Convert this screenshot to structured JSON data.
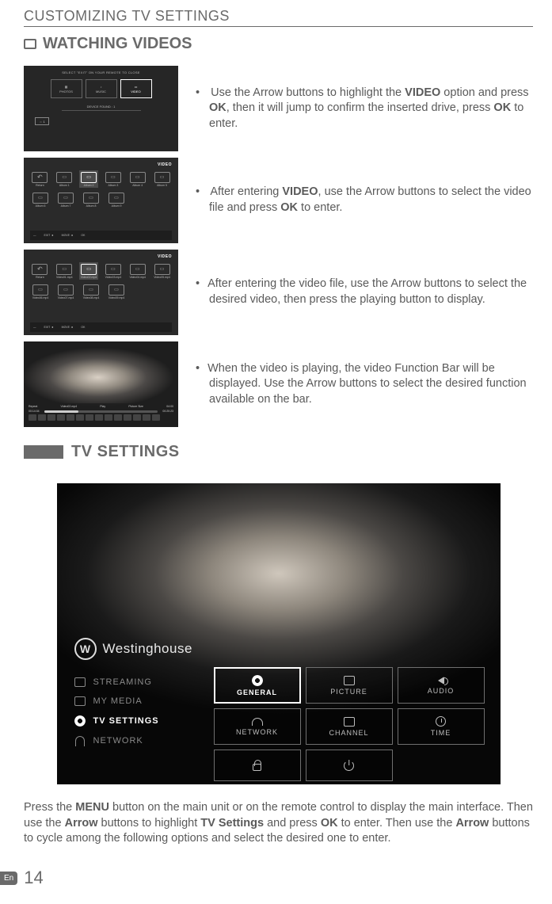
{
  "header": "CUSTOMIZING TV SETTINGS",
  "section1": {
    "title": "WATCHING VIDEOS",
    "steps": [
      {
        "text_pre": "Use the Arrow buttons to highlight the ",
        "b1": "VIDEO",
        "mid1": " option and press ",
        "b2": "OK",
        "mid2": ", then it will jump to confirm the inserted drive, press ",
        "b3": "OK",
        "end": " to enter."
      },
      {
        "text_pre": "After entering ",
        "b1": "VIDEO",
        "mid1": ", use the Arrow buttons to select the video file and press ",
        "b2": "OK",
        "end": " to enter."
      },
      {
        "full": "After entering the video file, use the Arrow buttons to select the desired video, then press the playing button to display."
      },
      {
        "full": "When the video is playing, the video Function Bar will be displayed. Use the Arrow buttons to select the desired function available on the bar."
      }
    ]
  },
  "thumb1": {
    "top_label": "SELECT \"EXIT\" ON YOUR REMOTE TO CLOSE",
    "cards": [
      "PHOTOS",
      "MUSIC",
      "VIDEO"
    ],
    "device": "DEVICE FOUND : 1",
    "usb": "⇔ 1"
  },
  "thumb2": {
    "header": "VIDEO",
    "row1": [
      "Return",
      "Album 1",
      "Album 2",
      "Album 3",
      "Album 4",
      "Album 5"
    ],
    "row2": [
      "Album 6",
      "Album 7",
      "Album 8",
      "Album 9"
    ],
    "bottom": [
      "—",
      "EXIT ◄",
      "MOVE ◄",
      "OK"
    ]
  },
  "thumb3": {
    "header": "VIDEO",
    "row1": [
      "Return",
      "Video01.mp4",
      "Video02.mp4",
      "Video03.mp4",
      "Video04.mp4",
      "Video05.mp4"
    ],
    "row2": [
      "Video06.mp4",
      "Video07.mp4",
      "Video08.mp4",
      "Video09.mp4"
    ],
    "bottom": [
      "—",
      "EXIT ◄",
      "MOVE ◄",
      "OK"
    ]
  },
  "thumb4": {
    "labels": [
      "Repeat",
      "Video02.mp4",
      "Play",
      "Picture Size",
      "04:00"
    ],
    "time_l": "00:14:04",
    "time_r": "00:20:23"
  },
  "section2": {
    "title": "TV SETTINGS"
  },
  "tv": {
    "brand": "Westinghouse",
    "left_menu": [
      "STREAMING",
      "MY MEDIA",
      "TV SETTINGS",
      "NETWORK"
    ],
    "tiles": [
      "GENERAL",
      "PICTURE",
      "AUDIO",
      "NETWORK",
      "CHANNEL",
      "TIME"
    ]
  },
  "body": {
    "p1a": "Press the ",
    "b1": "MENU",
    "p1b": " button on the main unit or on the remote control to display the main interface. Then use the ",
    "b2": "Arrow",
    "p1c": " buttons to highlight ",
    "b3": "TV Settings",
    "p1d": " and press ",
    "b4": "OK",
    "p1e": " to enter. Then use the ",
    "b5": "Arrow",
    "p1f": " buttons to cycle among the following options and select the desired one to enter."
  },
  "footer": {
    "lang": "En",
    "page": "14"
  }
}
